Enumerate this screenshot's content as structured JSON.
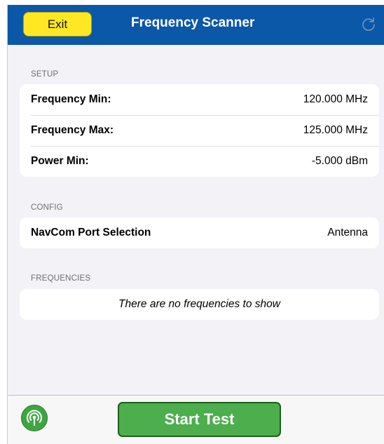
{
  "navbar": {
    "exit_label": "Exit",
    "title": "Frequency Scanner",
    "refresh_icon": "refresh-icon"
  },
  "setup": {
    "header": "SETUP",
    "rows": [
      {
        "label": "Frequency Min:",
        "value": "120.000 MHz"
      },
      {
        "label": "Frequency Max:",
        "value": "125.000 MHz"
      },
      {
        "label": "Power Min:",
        "value": "-5.000 dBm"
      }
    ]
  },
  "config": {
    "header": "CONFIG",
    "rows": [
      {
        "label": "NavCom Port Selection",
        "value": "Antenna"
      }
    ]
  },
  "frequencies": {
    "header": "FREQUENCIES",
    "empty_text": "There are no frequencies to show"
  },
  "toolbar": {
    "antenna_icon": "antenna-icon",
    "start_label": "Start Test"
  },
  "colors": {
    "navbar": "#0b57a8",
    "exit_button": "#ffe823",
    "start_button": "#4cae4c",
    "antenna_button": "#3ea640"
  }
}
